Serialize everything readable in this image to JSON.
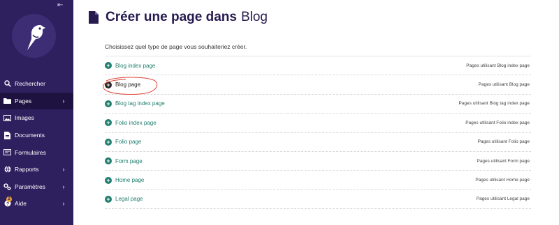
{
  "sidebar": {
    "items": [
      {
        "label": "Rechercher",
        "icon": "search-icon",
        "chevron": false
      },
      {
        "label": "Pages",
        "icon": "folder-icon",
        "chevron": true,
        "active": true
      },
      {
        "label": "Images",
        "icon": "image-icon",
        "chevron": false
      },
      {
        "label": "Documents",
        "icon": "document-icon",
        "chevron": false
      },
      {
        "label": "Formulaires",
        "icon": "form-icon",
        "chevron": false
      },
      {
        "label": "Rapports",
        "icon": "globe-icon",
        "chevron": true
      },
      {
        "label": "Paramètres",
        "icon": "cogs-icon",
        "chevron": true
      },
      {
        "label": "Aide",
        "icon": "help-icon",
        "chevron": true,
        "badge": "2"
      }
    ]
  },
  "header": {
    "title": "Créer une page dans",
    "subtitle": "Blog"
  },
  "intro": "Choisissez quel type de page vous souhaiteriez créer.",
  "page_types": [
    {
      "label": "Blog index page",
      "note": "Pages utilisant Blog index page"
    },
    {
      "label": "Blog page",
      "note": "Pages utilisant Blog page"
    },
    {
      "label": "Blog tag index page",
      "note": "Pages utilisant Blog tag index page"
    },
    {
      "label": "Folio index page",
      "note": "Pages utilisant Folio index page"
    },
    {
      "label": "Folio page",
      "note": "Pages utilisant Folio page"
    },
    {
      "label": "Form page",
      "note": "Pages utilisant Form page"
    },
    {
      "label": "Home page",
      "note": "Pages utilisant Home page"
    },
    {
      "label": "Legal page",
      "note": "Pages utilisant Legal page"
    }
  ],
  "colors": {
    "sidebar_bg": "#2e1f5e",
    "accent": "#1f7e6e",
    "annotation": "#e0453a"
  }
}
